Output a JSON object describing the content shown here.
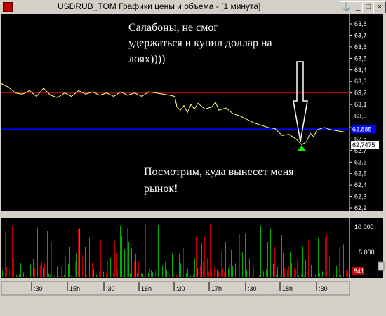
{
  "window": {
    "title": "USDRUB_TOM Графики цены и объема - [1 минута]",
    "buttons": [
      "anchor-icon",
      "minimize-icon",
      "maximize-icon",
      "close-icon"
    ]
  },
  "annotations": {
    "top": [
      "Салабоны, не смог",
      "удержаться и купил доллар на",
      "лоях))))"
    ],
    "bottom": [
      "Посмотрим, куда вынесет меня",
      "рынок!"
    ]
  },
  "price_axis": {
    "ticks": [
      "63,8",
      "63,7",
      "63,6",
      "63,5",
      "63,4",
      "63,3",
      "63,2",
      "63,1",
      "63,0",
      "62,9",
      "62,8",
      "62,7",
      "62,6",
      "62,5",
      "62,4",
      "62,3",
      "62,2"
    ],
    "current_price": "62,885",
    "buy_price": "62,7475"
  },
  "volume_axis": {
    "ticks": [
      "10 000",
      "5 000"
    ],
    "current_volume": "841"
  },
  "time_axis": {
    "labels": [
      ":30",
      "15h",
      ":30",
      "16h",
      ":30",
      "17h",
      ":30",
      "18h",
      ":30"
    ]
  },
  "colors": {
    "background": "#000000",
    "price_line": "#ffff80",
    "red_level": "#c00000",
    "blue_level": "#0000ff",
    "volume_up": "#00b000",
    "volume_down": "#c00000",
    "buy_marker": "#00ff00"
  },
  "chart_data": {
    "type": "line",
    "price": {
      "ylim": [
        62.2,
        63.8
      ],
      "levels": {
        "red": 63.2,
        "blue": 62.885
      },
      "buy_marker": 62.7475,
      "points": [
        [
          0,
          63.28
        ],
        [
          10,
          63.25
        ],
        [
          20,
          63.2
        ],
        [
          30,
          63.19
        ],
        [
          40,
          63.22
        ],
        [
          50,
          63.17
        ],
        [
          60,
          63.24
        ],
        [
          70,
          63.18
        ],
        [
          80,
          63.16
        ],
        [
          90,
          63.2
        ],
        [
          100,
          63.17
        ],
        [
          110,
          63.22
        ],
        [
          120,
          63.19
        ],
        [
          130,
          63.21
        ],
        [
          140,
          63.18
        ],
        [
          150,
          63.2
        ],
        [
          160,
          63.17
        ],
        [
          170,
          63.21
        ],
        [
          180,
          63.18
        ],
        [
          190,
          63.2
        ],
        [
          200,
          63.17
        ],
        [
          210,
          63.21
        ],
        [
          220,
          63.2
        ],
        [
          230,
          63.19
        ],
        [
          240,
          63.18
        ],
        [
          247,
          63.17
        ],
        [
          250,
          63.08
        ],
        [
          255,
          63.05
        ],
        [
          260,
          63.09
        ],
        [
          265,
          63.03
        ],
        [
          270,
          63.1
        ],
        [
          275,
          63.06
        ],
        [
          280,
          63.11
        ],
        [
          290,
          63.06
        ],
        [
          300,
          63.08
        ],
        [
          305,
          63.12
        ],
        [
          310,
          63.05
        ],
        [
          320,
          63.07
        ],
        [
          330,
          63.02
        ],
        [
          340,
          63.0
        ],
        [
          350,
          62.97
        ],
        [
          360,
          62.94
        ],
        [
          370,
          62.92
        ],
        [
          380,
          62.9
        ],
        [
          390,
          62.89
        ],
        [
          400,
          62.83
        ],
        [
          410,
          62.84
        ],
        [
          420,
          62.8
        ],
        [
          428,
          62.75
        ],
        [
          435,
          62.78
        ],
        [
          440,
          62.85
        ],
        [
          445,
          62.82
        ],
        [
          450,
          62.88
        ],
        [
          460,
          62.9
        ],
        [
          470,
          62.88
        ],
        [
          480,
          62.87
        ],
        [
          490,
          62.86
        ]
      ]
    },
    "volume": {
      "ylim": [
        0,
        12000
      ]
    }
  }
}
